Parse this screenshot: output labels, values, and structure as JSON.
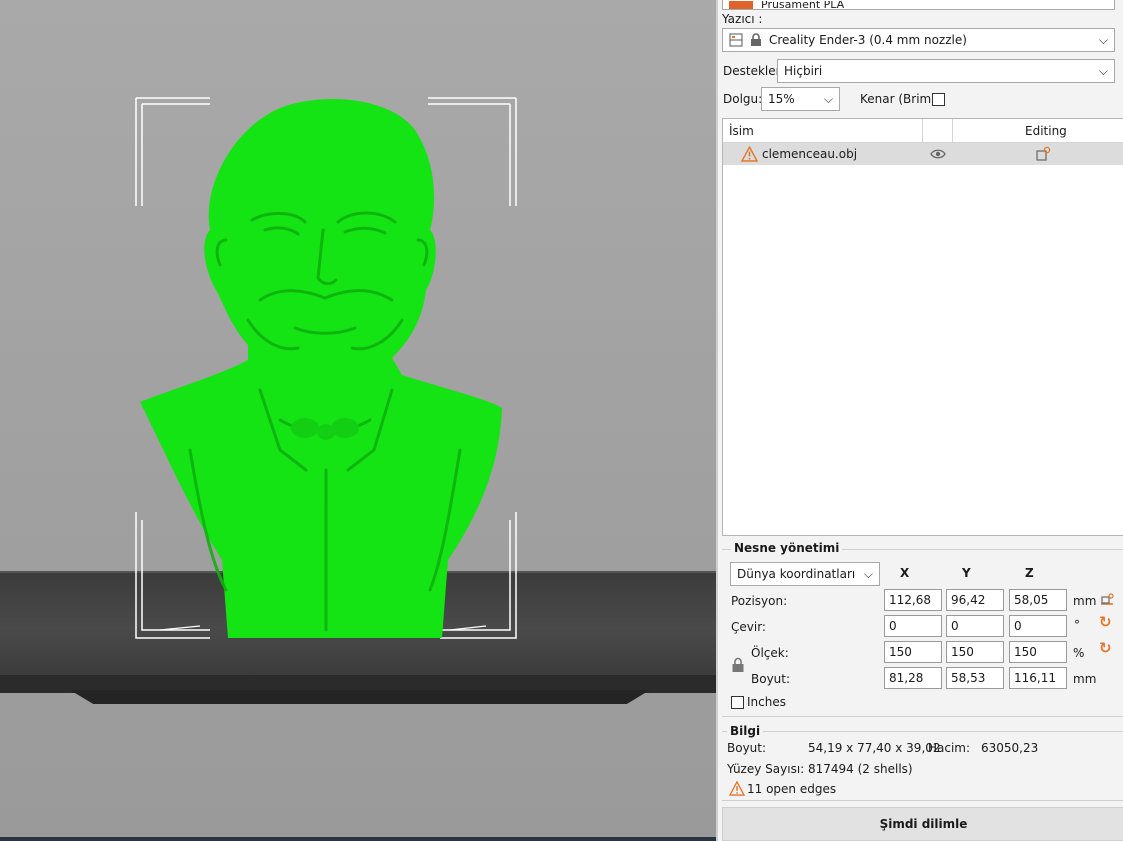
{
  "panel": {
    "filament_partial": "Prusament PLA",
    "printer_label": "Yazıcı :",
    "printer_value": "Creality Ender-3 (0.4 mm nozzle)",
    "supports_label": "Destekler:",
    "supports_value": "Hiçbiri",
    "infill_label": "Dolgu:",
    "infill_value": "15%",
    "brim_label": "Kenar (Brim):",
    "brim_checked": false
  },
  "object_list": {
    "columns": [
      "İsim",
      "",
      "Editing"
    ],
    "rows": [
      {
        "name": "clemenceau.obj",
        "warning": true,
        "visible": true
      }
    ]
  },
  "manipulation": {
    "title": "Nesne yönetimi",
    "coord_system": "Dünya koordinatları",
    "axes": [
      "X",
      "Y",
      "Z"
    ],
    "rows": [
      {
        "label": "Pozisyon:",
        "values": [
          "112,68",
          "96,42",
          "58,05"
        ],
        "unit": "mm"
      },
      {
        "label": "Çevir:",
        "values": [
          "0",
          "0",
          "0"
        ],
        "unit": "°"
      },
      {
        "label": "Ölçek:",
        "values": [
          "150",
          "150",
          "150"
        ],
        "unit": "%"
      },
      {
        "label": "Boyut:",
        "values": [
          "81,28",
          "58,53",
          "116,11"
        ],
        "unit": "mm"
      }
    ],
    "inches_label": "Inches"
  },
  "info": {
    "title": "Bilgi",
    "size_label": "Boyut:",
    "size_value": "54,19 x 77,40 x 39,02",
    "volume_label": "Hacim:",
    "volume_value": "63050,23",
    "facets_label": "Yüzey Sayısı:",
    "facets_value": "817494 (2 shells)",
    "warning_text": "11 open edges"
  },
  "slice_button": "Şimdi dilimle",
  "colors": {
    "model_green": "#14e414",
    "accent_orange": "#e4762a",
    "bed_dark": "#3f3f3f"
  }
}
